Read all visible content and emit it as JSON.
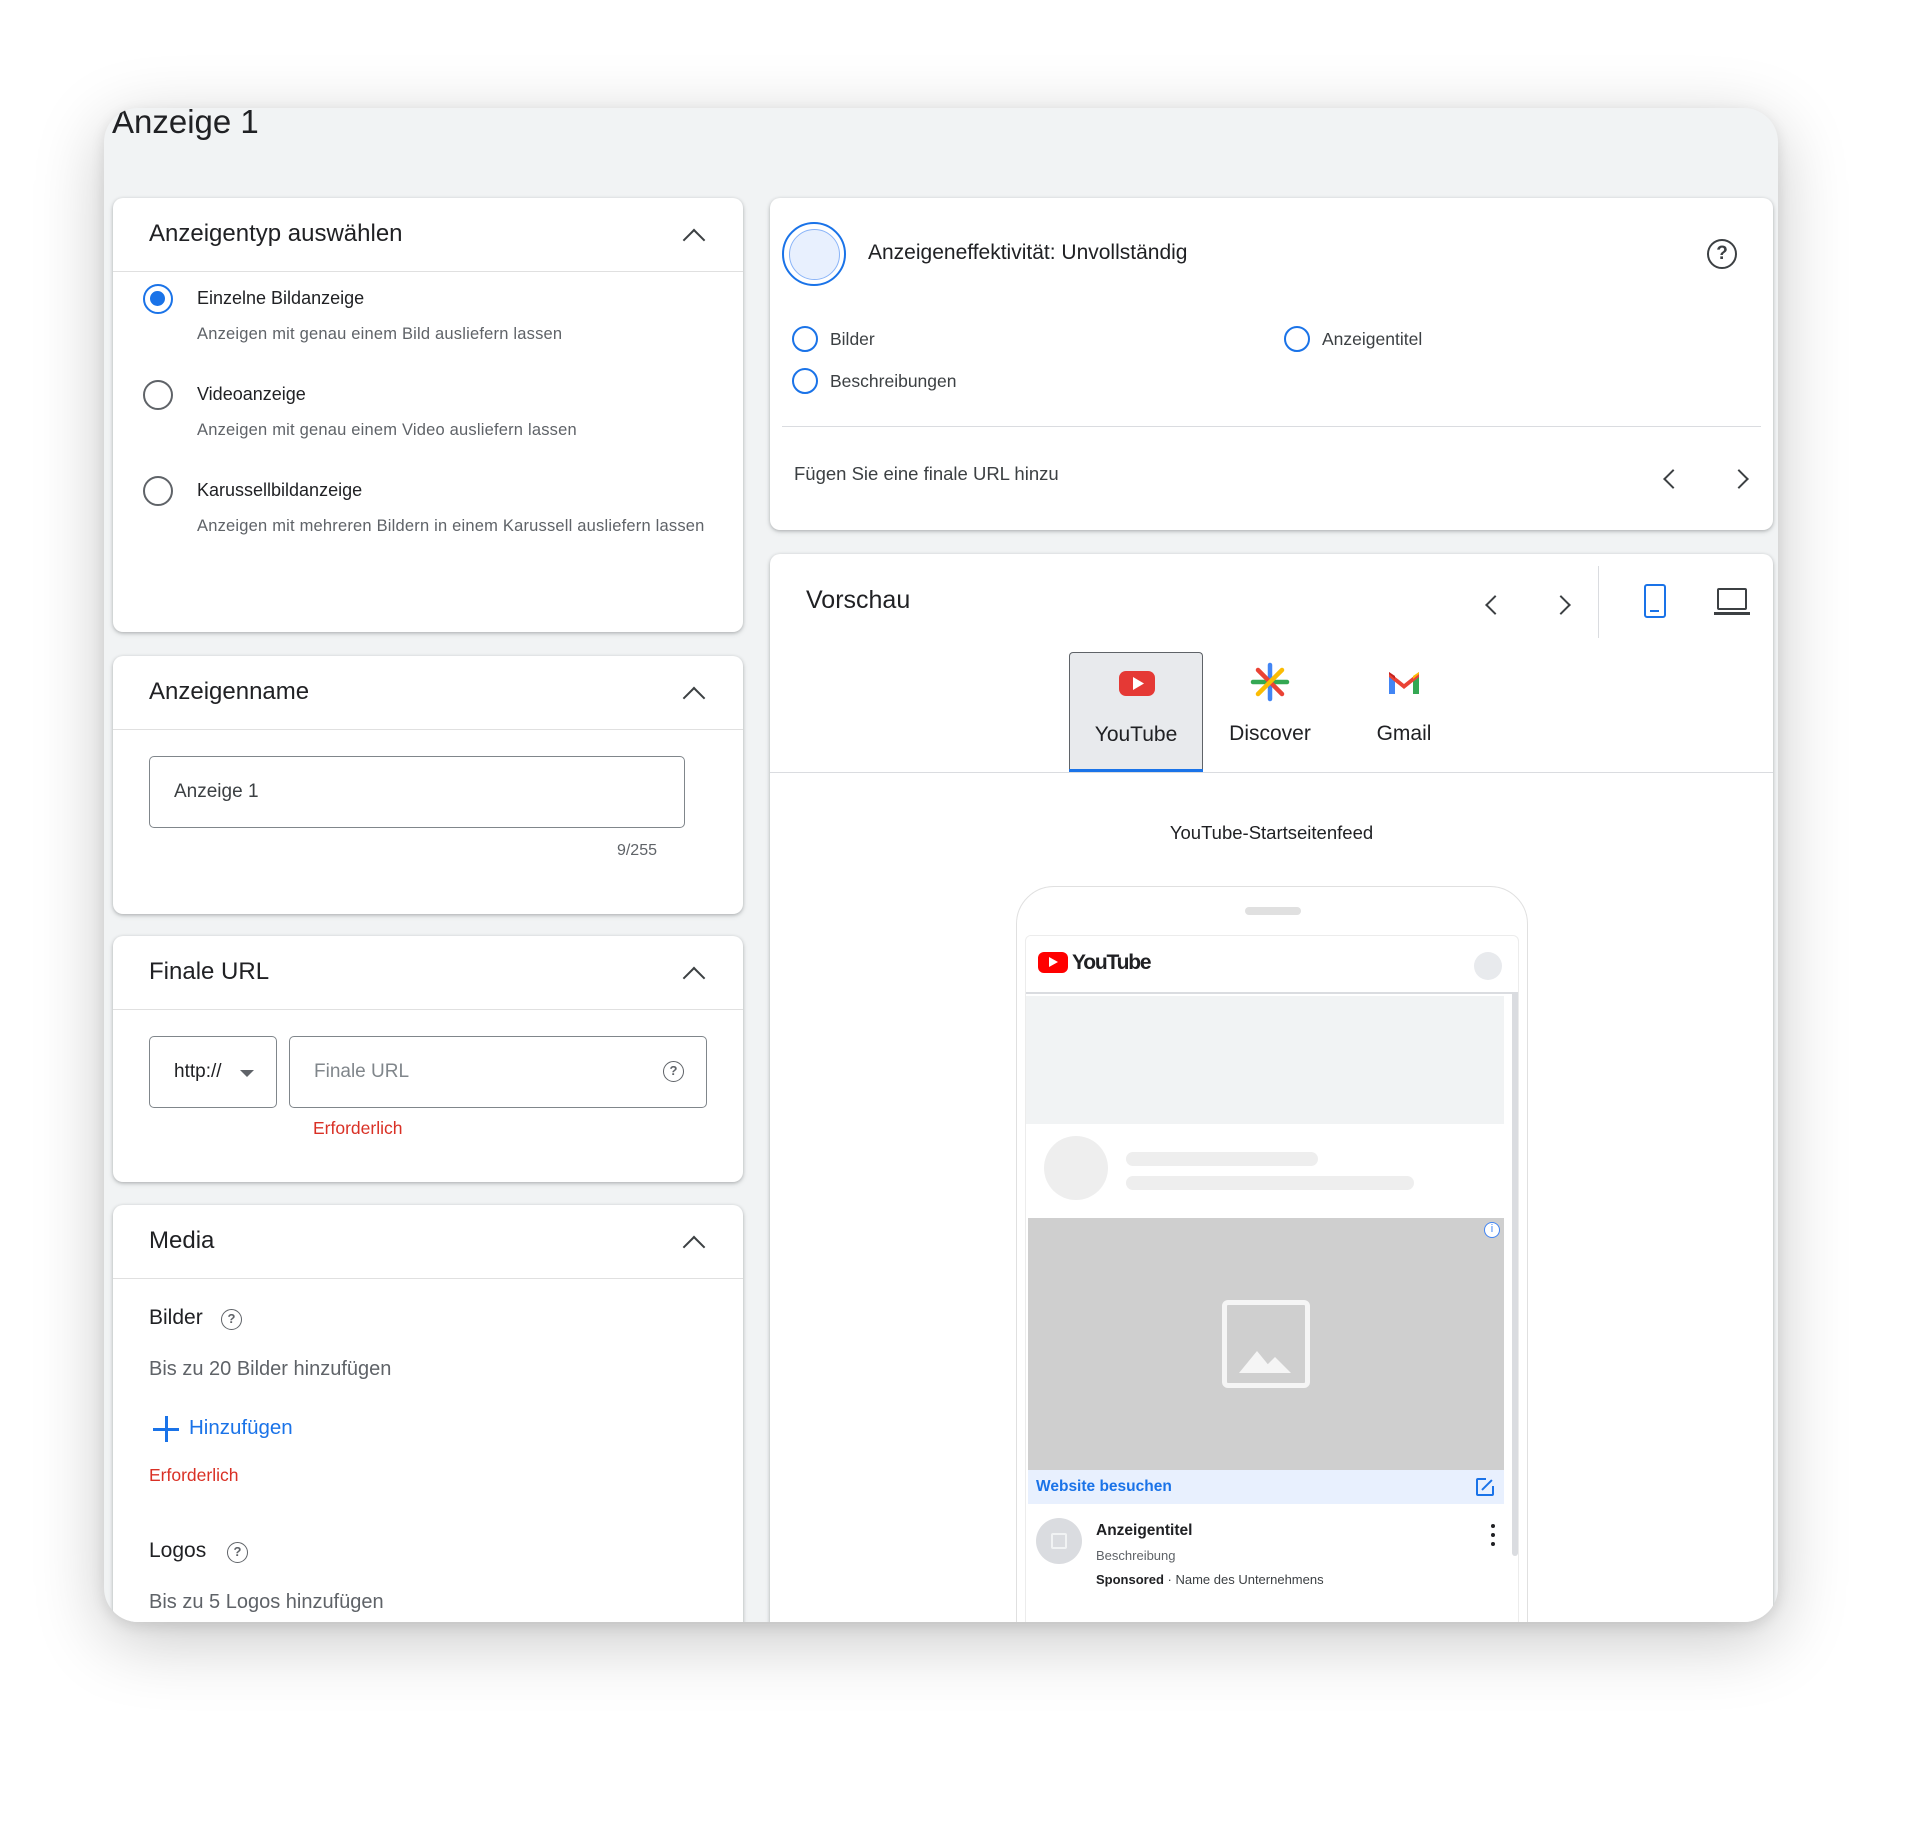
{
  "page": {
    "title": "Anzeige 1"
  },
  "ad_type": {
    "heading": "Anzeigentyp auswählen",
    "options": [
      {
        "label": "Einzelne Bildanzeige",
        "description": "Anzeigen mit genau einem Bild ausliefern lassen",
        "selected": true
      },
      {
        "label": "Videoanzeige",
        "description": "Anzeigen mit genau einem Video ausliefern lassen",
        "selected": false
      },
      {
        "label": "Karussellbildanzeige",
        "description": "Anzeigen mit mehreren Bildern in einem Karussell ausliefern lassen",
        "selected": false
      }
    ]
  },
  "ad_name": {
    "heading": "Anzeigenname",
    "value": "Anzeige 1",
    "counter": "9/255"
  },
  "final_url": {
    "heading": "Finale URL",
    "protocol": "http://",
    "placeholder": "Finale URL",
    "error": "Erforderlich"
  },
  "media": {
    "heading": "Media",
    "images": {
      "label": "Bilder",
      "hint": "Bis zu 20 Bilder hinzufügen",
      "add_label": "Hinzufügen",
      "error": "Erforderlich"
    },
    "logos": {
      "label": "Logos",
      "hint": "Bis zu 5 Logos hinzufügen"
    }
  },
  "effectiveness": {
    "title": "Anzeigeneffektivität: Unvollständig",
    "items": [
      "Bilder",
      "Anzeigentitel",
      "Beschreibungen"
    ],
    "hint": "Fügen Sie eine finale URL hinzu"
  },
  "preview": {
    "title": "Vorschau",
    "tabs": [
      {
        "label": "YouTube",
        "icon": "youtube-icon",
        "selected": true
      },
      {
        "label": "Discover",
        "icon": "discover-icon",
        "selected": false
      },
      {
        "label": "Gmail",
        "icon": "gmail-icon",
        "selected": false
      }
    ],
    "feed_label": "YouTube-Startseitenfeed",
    "mock": {
      "logo_text": "YouTube",
      "visit_label": "Website besuchen",
      "ad_title": "Anzeigentitel",
      "ad_description": "Beschreibung",
      "sponsored": "Sponsored",
      "separator": " · ",
      "company": "Name des Unternehmens"
    }
  },
  "colors": {
    "accent": "#1a73e8",
    "error": "#d93025",
    "background": "#f1f3f4"
  }
}
